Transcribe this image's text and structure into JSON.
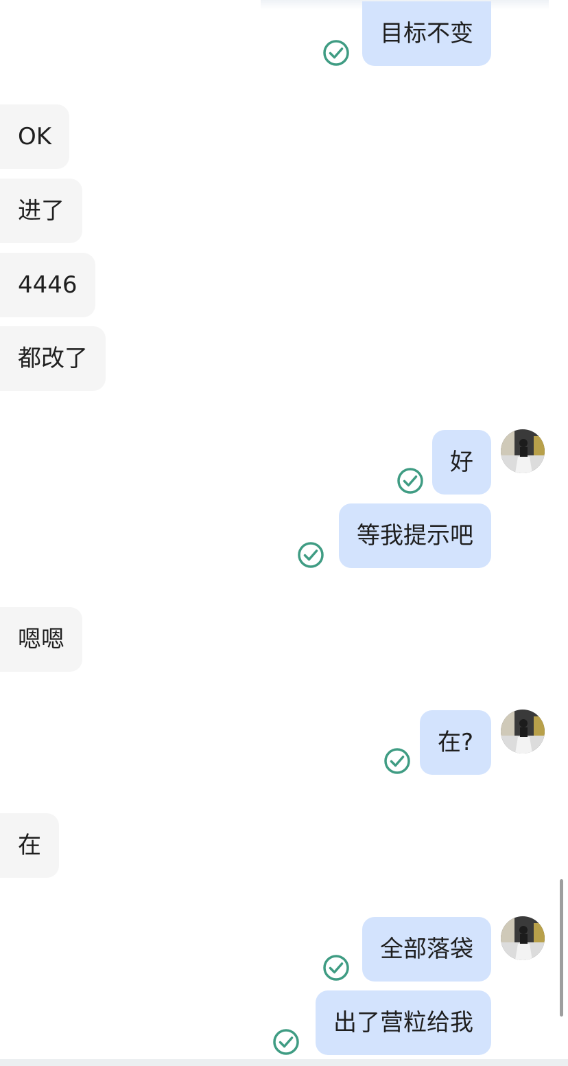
{
  "chat": {
    "messages": [
      {
        "id": "m1",
        "direction": "outgoing",
        "text": "目标不变",
        "status": "read"
      },
      {
        "id": "m2",
        "direction": "incoming",
        "text": "OK"
      },
      {
        "id": "m3",
        "direction": "incoming",
        "text": "进了"
      },
      {
        "id": "m4",
        "direction": "incoming",
        "text": "4446"
      },
      {
        "id": "m5",
        "direction": "incoming",
        "text": "都改了"
      },
      {
        "id": "m6",
        "direction": "outgoing",
        "text": "好",
        "status": "read"
      },
      {
        "id": "m7",
        "direction": "outgoing",
        "text": "等我提示吧",
        "status": "read"
      },
      {
        "id": "m8",
        "direction": "incoming",
        "text": "嗯嗯"
      },
      {
        "id": "m9",
        "direction": "outgoing",
        "text": "在?",
        "status": "read"
      },
      {
        "id": "m10",
        "direction": "incoming",
        "text": "在"
      },
      {
        "id": "m11",
        "direction": "outgoing",
        "text": "全部落袋",
        "status": "read"
      },
      {
        "id": "m12",
        "direction": "outgoing",
        "text": "出了营粒给我",
        "status": "read"
      }
    ]
  },
  "colors": {
    "outgoing_bubble": "#d3e3fd",
    "incoming_bubble": "#f5f5f5",
    "read_check": "#3f9c83"
  },
  "icons": {
    "read_receipt": "check-circle-icon",
    "sender_avatar": "avatar"
  }
}
